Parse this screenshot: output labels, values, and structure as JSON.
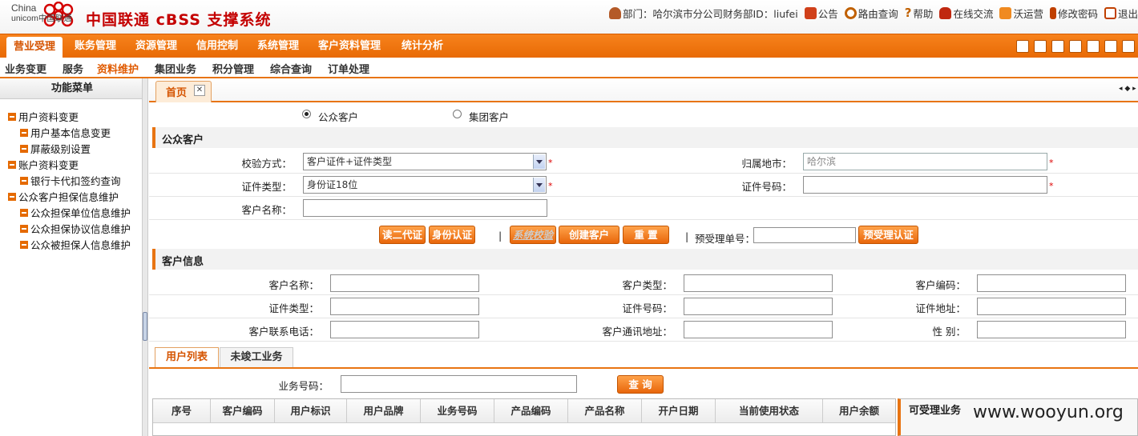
{
  "header": {
    "logo_en_1": "China",
    "logo_en_2": "unicom中国联通",
    "title": "中国联通 cBSS 支撑系统",
    "user_info": "部门：哈尔滨市分公司财务部ID：liufei",
    "links": [
      "公告",
      "路由查询",
      "帮助",
      "在线交流",
      "沃运营",
      "修改密码",
      "退出"
    ]
  },
  "nav": {
    "items": [
      "营业受理",
      "账务管理",
      "资源管理",
      "信用控制",
      "系统管理",
      "客户资料管理",
      "统计分析"
    ],
    "active": "营业受理"
  },
  "subnav": {
    "items": [
      "业务变更",
      "服务",
      "资料维护",
      "集团业务",
      "积分管理",
      "综合查询",
      "订单处理"
    ],
    "active": "资料维护"
  },
  "sidebar": {
    "title": "功能菜单",
    "items": [
      {
        "label": "用户资料变更",
        "level": 1
      },
      {
        "label": "用户基本信息变更",
        "level": 2
      },
      {
        "label": "屏蔽级别设置",
        "level": 2
      },
      {
        "label": "账户资料变更",
        "level": 1
      },
      {
        "label": "银行卡代扣签约查询",
        "level": 2
      },
      {
        "label": "公众客户担保信息维护",
        "level": 1
      },
      {
        "label": "公众担保单位信息维护",
        "level": 2
      },
      {
        "label": "公众担保协议信息维护",
        "level": 2
      },
      {
        "label": "公众被担保人信息维护",
        "level": 2
      }
    ]
  },
  "tabs": {
    "home": "首页",
    "close": "✕",
    "arrows": "◂ ◆ ▸"
  },
  "customer_type": {
    "option1": "公众客户",
    "option2": "集团客户",
    "selected": "公众客户"
  },
  "public_customer": {
    "section_title": "公众客户",
    "verify_method_label": "校验方式：",
    "verify_method_value": "客户证件+证件类型",
    "home_city_label": "归属地市：",
    "home_city_value": "哈尔滨",
    "id_type_label": "证件类型：",
    "id_type_value": "身份证18位",
    "id_number_label": "证件号码：",
    "id_number_value": "",
    "customer_name_label": "客户名称：",
    "customer_name_value": "",
    "required_mark": "*"
  },
  "actions": {
    "read_id": "读二代证",
    "id_auth": "身份认证",
    "sep": "|",
    "system_verify": "系统校验",
    "create_customer": "创建客户",
    "reset": "重 置",
    "pre_order_label": "预受理单号：",
    "pre_order_value": "",
    "pre_auth": "预受理认证"
  },
  "customer_info": {
    "section_title": "客户信息",
    "fields": [
      {
        "label": "客户名称：",
        "value": ""
      },
      {
        "label": "客户类型：",
        "value": ""
      },
      {
        "label": "客户编码：",
        "value": ""
      },
      {
        "label": "证件类型：",
        "value": ""
      },
      {
        "label": "证件号码：",
        "value": ""
      },
      {
        "label": "证件地址：",
        "value": ""
      },
      {
        "label": "客户联系电话：",
        "value": ""
      },
      {
        "label": "客户通讯地址：",
        "value": ""
      },
      {
        "label": "性 别：",
        "value": ""
      }
    ]
  },
  "bottom_tabs": {
    "user_list": "用户列表",
    "pending": "未竣工业务",
    "active": "用户列表"
  },
  "query": {
    "label": "业务号码：",
    "value": "",
    "button": "查 询"
  },
  "table": {
    "columns": [
      "序号",
      "客户编码",
      "用户标识",
      "用户品牌",
      "业务号码",
      "产品编码",
      "产品名称",
      "开户日期",
      "当前使用状态",
      "用户余额"
    ]
  },
  "available_panel": {
    "title": "可受理业务"
  },
  "watermark": "www.wooyun.org",
  "colors": {
    "accent": "#e87412",
    "brand_red": "#c40000"
  }
}
